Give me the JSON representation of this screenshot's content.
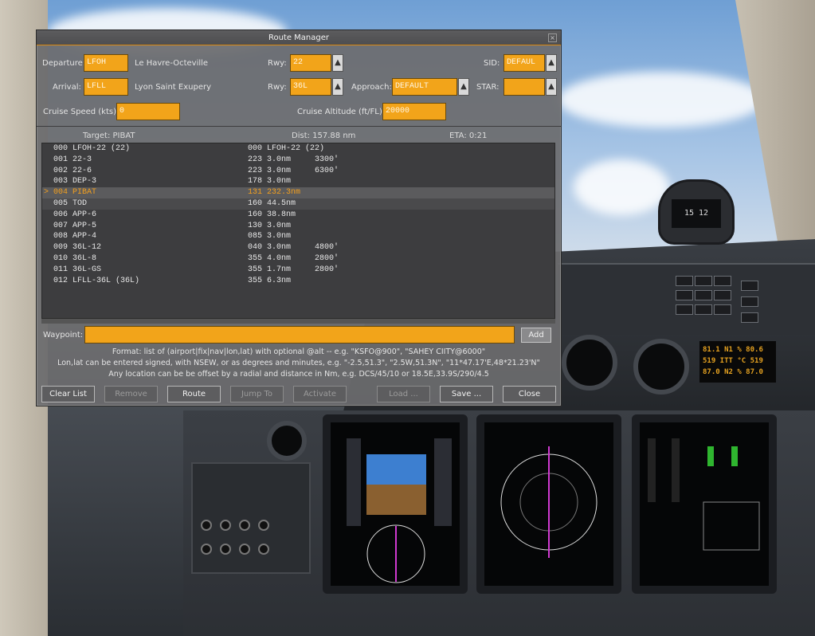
{
  "dialog": {
    "title": "Route Manager",
    "departure": {
      "label": "Departure:",
      "airport": "LFOH",
      "name": "Le Havre-Octeville",
      "rwy_label": "Rwy:",
      "rwy": "22",
      "sid_label": "SID:",
      "sid": "DEFAUL"
    },
    "arrival": {
      "label": "Arrival:",
      "airport": "LFLL",
      "name": "Lyon Saint Exupery",
      "rwy_label": "Rwy:",
      "rwy": "36L",
      "approach_label": "Approach:",
      "approach": "DEFAULT",
      "star_label": "STAR:",
      "star": ""
    },
    "cruise": {
      "speed_label": "Cruise Speed (kts):",
      "speed": "0",
      "alt_label": "Cruise Altitude (ft/FL):",
      "alt": "20000"
    },
    "info": {
      "target": "Target: PIBAT",
      "dist": "Dist: 157.88 nm",
      "eta": "ETA: 0:21"
    },
    "waypoints": [
      {
        "mk": "",
        "id": "000",
        "name": "LFOH-22 (22)",
        "hdg": "000",
        "dist": "LFOH-22 (22)",
        "alt": ""
      },
      {
        "mk": "",
        "id": "001",
        "name": "22-3",
        "hdg": "223",
        "dist": "3.0nm",
        "alt": "3300'"
      },
      {
        "mk": "",
        "id": "002",
        "name": "22-6",
        "hdg": "223",
        "dist": "3.0nm",
        "alt": "6300'"
      },
      {
        "mk": "",
        "id": "003",
        "name": "DEP-3",
        "hdg": "178",
        "dist": "3.0nm",
        "alt": ""
      },
      {
        "mk": ">",
        "id": "004",
        "name": "PIBAT",
        "hdg": "131",
        "dist": "232.3nm",
        "alt": ""
      },
      {
        "mk": "",
        "id": "005",
        "name": "TOD",
        "hdg": "160",
        "dist": "44.5nm",
        "alt": ""
      },
      {
        "mk": "",
        "id": "006",
        "name": "APP-6",
        "hdg": "160",
        "dist": "38.8nm",
        "alt": ""
      },
      {
        "mk": "",
        "id": "007",
        "name": "APP-5",
        "hdg": "130",
        "dist": "3.0nm",
        "alt": ""
      },
      {
        "mk": "",
        "id": "008",
        "name": "APP-4",
        "hdg": "085",
        "dist": "3.0nm",
        "alt": ""
      },
      {
        "mk": "",
        "id": "009",
        "name": "36L-12",
        "hdg": "040",
        "dist": "3.0nm",
        "alt": "4800'"
      },
      {
        "mk": "",
        "id": "010",
        "name": "36L-8",
        "hdg": "355",
        "dist": "4.0nm",
        "alt": "2800'"
      },
      {
        "mk": "",
        "id": "011",
        "name": "36L-GS",
        "hdg": "355",
        "dist": "1.7nm",
        "alt": "2800'"
      },
      {
        "mk": "",
        "id": "012",
        "name": "LFLL-36L (36L)",
        "hdg": "355",
        "dist": "6.3nm",
        "alt": ""
      }
    ],
    "waypoint_input": {
      "label": "Waypoint:",
      "value": "",
      "add_label": "Add"
    },
    "help": [
      "Format: list of (airport|fix|nav|lon,lat) with optional @alt -- e.g. \"KSFO@900\", \"SAHEY CIITY@6000\"",
      "Lon,lat can be entered signed, with NSEW, or as degrees and minutes, e.g. \"-2.5,51.3\", \"2.5W,51.3N\", \"11*47.17'E,48*21.23'N\"",
      "Any location can be be offset by a radial and distance in Nm, e.g. DCS/45/10 or 18.5E,33.9S/290/4.5"
    ],
    "buttons": {
      "clear": "Clear List",
      "remove": "Remove",
      "route": "Route",
      "jump": "Jump To",
      "activate": "Activate",
      "load": "Load ...",
      "save": "Save ...",
      "close": "Close"
    }
  },
  "cockpit": {
    "compass_reading": "15 12",
    "engine_readout": [
      "81.1 N1 % 80.6",
      "519 ITT °C 519",
      "87.0 N2 % 87.0"
    ]
  },
  "colors": {
    "field": "#f2a41a",
    "selected_row": "#f4a01e",
    "dialog_bg": "#6c6c6e"
  }
}
